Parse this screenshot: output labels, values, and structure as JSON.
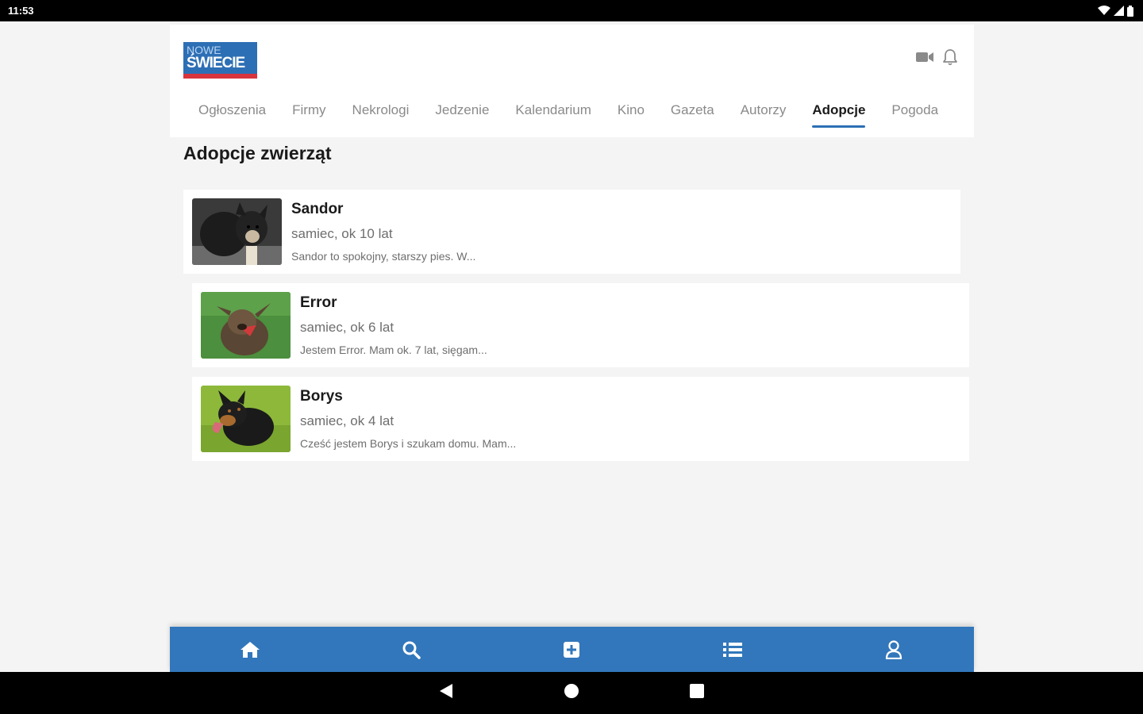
{
  "status_bar": {
    "time": "11:53"
  },
  "logo": {
    "line1": "NOWE",
    "line2": "ŚWIECIE"
  },
  "header": {
    "icons": [
      "video-icon",
      "bell-icon"
    ]
  },
  "tabs": [
    {
      "label": "Ogłoszenia",
      "active": false
    },
    {
      "label": "Firmy",
      "active": false
    },
    {
      "label": "Nekrologi",
      "active": false
    },
    {
      "label": "Jedzenie",
      "active": false
    },
    {
      "label": "Kalendarium",
      "active": false
    },
    {
      "label": "Kino",
      "active": false
    },
    {
      "label": "Gazeta",
      "active": false
    },
    {
      "label": "Autorzy",
      "active": false
    },
    {
      "label": "Adopcje",
      "active": true
    },
    {
      "label": "Pogoda",
      "active": false
    }
  ],
  "page": {
    "title": "Adopcje zwierząt"
  },
  "animals": [
    {
      "name": "Sandor",
      "meta": "samiec, ok 10 lat",
      "desc": "Sandor to spokojny, starszy pies. W..."
    },
    {
      "name": "Error",
      "meta": "samiec, ok 6 lat",
      "desc": "Jestem Error. Mam ok. 7 lat, sięgam..."
    },
    {
      "name": "Borys",
      "meta": "samiec, ok 4 lat",
      "desc": "Cześć jestem Borys i szukam domu. Mam..."
    }
  ],
  "bottom_nav": [
    "home-icon",
    "search-icon",
    "add-box-icon",
    "list-icon",
    "profile-icon"
  ],
  "colors": {
    "brand_blue": "#3277bb",
    "logo_red": "#d8343d",
    "active_tab_underline": "#2d6fb5"
  }
}
